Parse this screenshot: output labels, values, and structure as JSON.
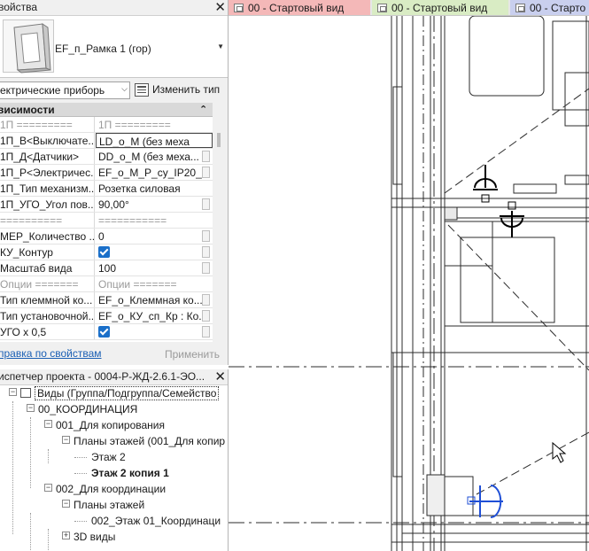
{
  "properties": {
    "title": "войства",
    "close_icon": "close-icon",
    "type_name": "EF_п_Рамка 1 (гор)",
    "filter_value": "ектрические приборь",
    "edit_type_label": "Изменить тип",
    "group_header": "висимости",
    "rows": [
      {
        "key": "1П =========",
        "value": "1П =========",
        "style": "dim"
      },
      {
        "key": "1П_В<Выключате...",
        "value": "LD_o_M (без меха",
        "style": "active"
      },
      {
        "key": "1П_Д<Датчики>",
        "value": "DD_o_M (без меха...",
        "style": "btn"
      },
      {
        "key": "1П_Р<Электричес...",
        "value": "EF_o_M_P_cy_IP20_...",
        "style": "btn"
      },
      {
        "key": "1П_Тип механизм...",
        "value": "Розетка силовая",
        "style": ""
      },
      {
        "key": "1П_УГО_Угол пов...",
        "value": "90,00°",
        "style": "btn"
      },
      {
        "key": "==========",
        "value": "===========",
        "style": "dim"
      },
      {
        "key": "MEP_Количество ...",
        "value": "0",
        "style": "btn"
      },
      {
        "key": "КУ_Контур",
        "value": "",
        "style": "check"
      },
      {
        "key": "Масштаб вида",
        "value": "100",
        "style": "btn"
      },
      {
        "key": "Опции =======",
        "value": "Опции =======",
        "style": "dim"
      },
      {
        "key": "Тип клеммной ко...",
        "value": "EF_o_Клеммная ко...",
        "style": "btn"
      },
      {
        "key": "Тип установочной...",
        "value": "EF_o_КУ_сп_Кр : Ко...",
        "style": "btn"
      },
      {
        "key": "УГО х 0,5",
        "value": "",
        "style": "check"
      }
    ],
    "help_link": "правка по свойствам",
    "apply_label": "Применить"
  },
  "browser": {
    "title": "испетчер проекта - 0004-Р-ЖД-2.6.1-ЭО...",
    "close_icon": "close-icon",
    "nodes": [
      {
        "label": "Виды (Группа/Подгруппа/Семейство",
        "indent": 0,
        "toggle": "-",
        "selected": true
      },
      {
        "label": "00_КООРДИНАЦИЯ",
        "indent": 1,
        "toggle": "-"
      },
      {
        "label": "001_Для копирования",
        "indent": 2,
        "toggle": "-"
      },
      {
        "label": "Планы этажей (001_Для копир",
        "indent": 3,
        "toggle": "-"
      },
      {
        "label": "Этаж 2",
        "indent": 4,
        "toggle": ""
      },
      {
        "label": "Этаж 2 копия 1",
        "indent": 4,
        "toggle": "",
        "bold": true
      },
      {
        "label": "002_Для координации",
        "indent": 2,
        "toggle": "-"
      },
      {
        "label": "Планы этажей",
        "indent": 3,
        "toggle": "-"
      },
      {
        "label": "002_Этаж 01_Координаци",
        "indent": 4,
        "toggle": ""
      },
      {
        "label": "3D виды",
        "indent": 3,
        "toggle": "+"
      }
    ]
  },
  "tabs": [
    {
      "label": "00 - Стартовый вид",
      "color": "#f4b8b8"
    },
    {
      "label": "00 - Стартовый вид",
      "color": "#d9ecc4"
    },
    {
      "label": "00 - Старто",
      "color": "#c9cfee"
    }
  ],
  "colors": {
    "accent_blue": "#1a6fc9",
    "link_blue": "#1a5fb4",
    "symbol_blue": "#1f4fd6"
  }
}
